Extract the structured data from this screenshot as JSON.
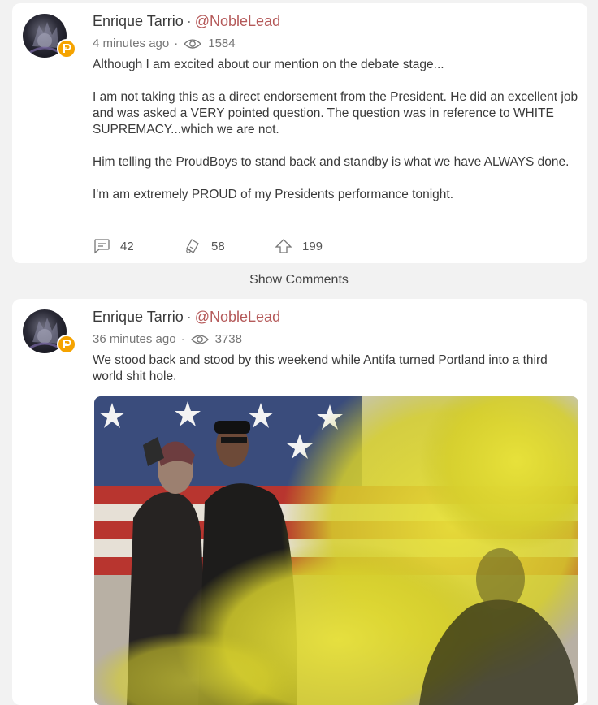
{
  "posts": [
    {
      "author": "Enrique Tarrio",
      "separator": "·",
      "handle": "@NobleLead",
      "time": "4 minutes ago",
      "meta_dot": "·",
      "views": "1584",
      "paragraphs": [
        "Although I am excited about our mention on the debate stage...",
        "I am not taking this as a direct endorsement from the President. He did an excellent job and was asked a VERY pointed question. The question was in reference to WHITE SUPREMACY...which we are not.",
        "Him telling the ProudBoys to stand back and standby is what we have ALWAYS done.",
        "I'm am extremely PROUD of my Presidents performance tonight."
      ],
      "comments": "42",
      "echoes": "58",
      "upvotes": "199"
    },
    {
      "author": "Enrique Tarrio",
      "separator": "·",
      "handle": "@NobleLead",
      "time": "36 minutes ago",
      "meta_dot": "·",
      "views": "3738",
      "paragraphs": [
        "We stood back and stood by this weekend while Antifa turned Portland into a third world shit hole."
      ]
    }
  ],
  "show_comments_label": "Show Comments",
  "icons": {
    "views": "eye-icon",
    "comments": "comment-icon",
    "echo": "echo-icon",
    "upvote": "upvote-icon",
    "badge": "parler-badge-icon"
  },
  "colors": {
    "handle": "#b55a5a",
    "badge": "#f5a300",
    "smoke": "#d9d21f"
  }
}
